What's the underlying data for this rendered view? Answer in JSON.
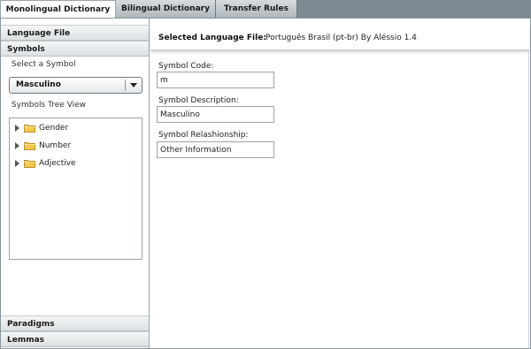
{
  "tabs": [
    {
      "label": "Monolingual Dictionary",
      "active": true
    },
    {
      "label": "Bilingual Dictionary",
      "active": false
    },
    {
      "label": "Transfer Rules",
      "active": false
    }
  ],
  "left_panel": {
    "sections": {
      "language_file": "Language File",
      "symbols": "Symbols",
      "paradigms": "Paradigms",
      "lemmas": "Lemmas"
    },
    "select_symbol_label": "Select a Symbol",
    "symbol_select": {
      "selected": "Masculino",
      "icon": "chevron-down-icon"
    },
    "tree_view_label": "Symbols Tree View",
    "tree_items": [
      {
        "label": "Gender",
        "icon": "folder-icon"
      },
      {
        "label": "Number",
        "icon": "folder-icon"
      },
      {
        "label": "Adjective",
        "icon": "folder-icon"
      }
    ]
  },
  "main": {
    "selected_file_label": "Selected Language File:",
    "selected_file_value": "Português Brasil (pt-br) By Aléssio 1.4",
    "fields": {
      "symbol_code": {
        "label": "Symbol Code:",
        "value": "m"
      },
      "symbol_description": {
        "label": "Symbol Description:",
        "value": "Masculino"
      },
      "symbol_relationship": {
        "label": "Symbol Relashionship:",
        "value": "Other Information"
      }
    }
  },
  "colors": {
    "tabbar_bg": "#7c8a92",
    "folder_yellow": "#f2c94c"
  }
}
